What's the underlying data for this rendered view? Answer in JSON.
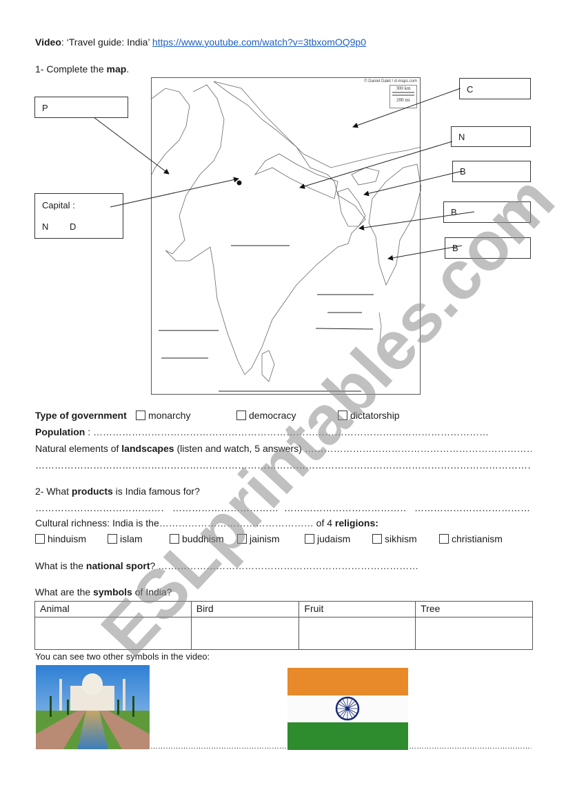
{
  "header": {
    "video_label": "Video",
    "video_title": ": ‘Travel guide: India’ ",
    "video_url": "https://www.youtube.com/watch?v=3tbxomOQ9p0"
  },
  "section1": {
    "prefix": "1- Complete the ",
    "bold": "map",
    "suffix": "."
  },
  "map": {
    "credit": "© Daniel Dalet / d-maps.com",
    "scale_km": "300 km",
    "scale_mi": "200 mi",
    "boxes": {
      "p": "P",
      "capital_label": "Capital :",
      "capital_n": "N",
      "capital_d": "D",
      "c": "C",
      "n": "N",
      "b1": "B",
      "b2": "B",
      "b3": "B"
    }
  },
  "government": {
    "label": "Type of government",
    "options": [
      "monarchy",
      "democracy",
      "dictatorship"
    ]
  },
  "population": {
    "label": "Population",
    "sep": " : ",
    "dots": "……………………………………………………………………………………………………………"
  },
  "landscapes": {
    "prefix": "Natural elements of ",
    "bold": "landscapes",
    "suffix": " (listen and watch, 5 answers) ",
    "dots1": "……………………………………………………………………………",
    "dots2": "…………………………………………………………………………………………………………………………………………………………"
  },
  "section2": {
    "prefix": "2- What ",
    "bold": "products",
    "suffix": " is India famous for?",
    "blanks": [
      "…………………………………………",
      "…………………………………………",
      "……………………………………………",
      "…………………………………………"
    ]
  },
  "religions": {
    "prefix": "Cultural richness: India is the",
    "dots": "…………………………………………",
    "middle": " of 4 ",
    "bold": "religions:",
    "options": [
      "hinduism",
      "islam",
      "buddhism",
      "jainism",
      "judaism",
      "sikhism",
      "christianism"
    ]
  },
  "sport": {
    "prefix": "What is the ",
    "bold": "national sport",
    "suffix": "? ",
    "dots": "………………………………………………………………………"
  },
  "symbols": {
    "prefix": "What are the ",
    "bold": "symbols",
    "suffix": " of India?",
    "columns": [
      "Animal",
      "Bird",
      "Fruit",
      "Tree"
    ]
  },
  "other_symbols": {
    "text": "You can see two other symbols in the video:",
    "dots1": "………………………………………………………",
    "dots2": "………………………………………………………",
    "images": [
      "taj-mahal",
      "indian-flag"
    ]
  },
  "watermark": {
    "text": "ESLprintables.com",
    "color": "#8c8c8c"
  },
  "colors": {
    "link": "#1f5fbf",
    "flag_saffron": "#e8892a",
    "flag_white": "#ffffff",
    "flag_green": "#2e8b2e",
    "chakra": "#1a2a7a"
  }
}
